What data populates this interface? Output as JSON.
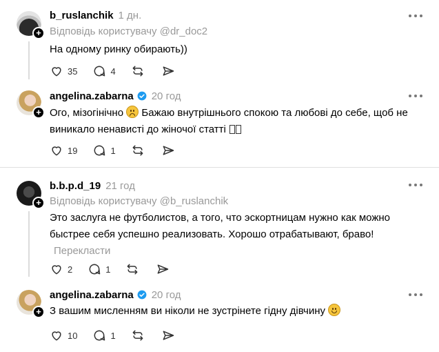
{
  "posts": [
    {
      "username": "b_ruslanchik",
      "time": "1 дн.",
      "reply_to": "Відповідь користувачу @dr_doc2",
      "text": "На одному ринку обирають))",
      "likes": "35",
      "comments": "4"
    },
    {
      "username": "angelina.zabarna",
      "time": "20 год",
      "text_a": "Ого, мізогінічно",
      "text_b": "Бажаю внутрішнього спокою та любові до себе, щоб не виникало ненависті до жіночої статті",
      "likes": "19",
      "comments": "1"
    },
    {
      "username": "b.b.p.d_19",
      "time": "21 год",
      "reply_to": "Відповідь користувачу @b_ruslanchik",
      "text": "Это заслуга не футболистов, а того, что эскортницам нужно как можно быстрее себя успешно реализовать. Хорошо отрабатывают, браво!",
      "translate": "Перекласти",
      "likes": "2",
      "comments": "1"
    },
    {
      "username": "angelina.zabarna",
      "time": "20 год",
      "text": "З вашим мисленням ви ніколи не зустрінете гідну дівчину",
      "likes": "10",
      "comments": "1"
    }
  ],
  "icons": {
    "like": "heart-icon",
    "comment": "comment-icon",
    "repost": "repost-icon",
    "share": "share-icon",
    "more": "more-icon",
    "verified": "verified-badge-icon"
  },
  "colors": {
    "verified": "#1d9bf0",
    "muted": "#999999"
  }
}
